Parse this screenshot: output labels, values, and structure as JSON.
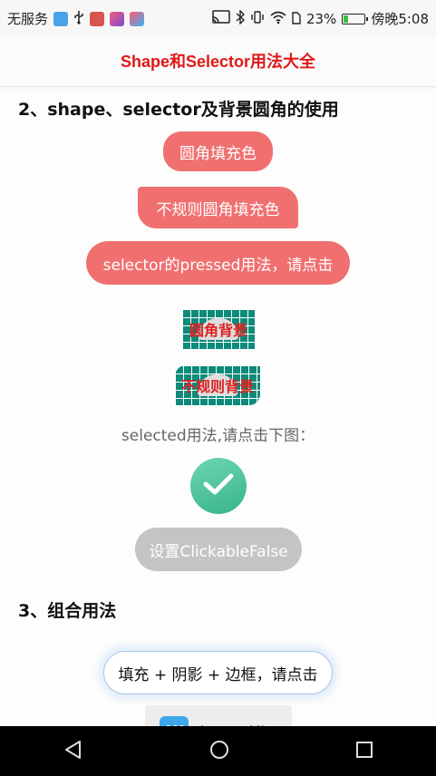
{
  "status_bar": {
    "carrier": "无服务",
    "battery_percent": "23%",
    "battery_level": 0.23,
    "time": "傍晚5:08",
    "icons": [
      "apowermirror-app-icon",
      "usb-icon",
      "huawei-app-icon",
      "app-icon",
      "app-icon",
      "cast-icon",
      "bluetooth-icon",
      "vibrate-icon",
      "wifi-icon",
      "sim-icon",
      "battery-icon"
    ]
  },
  "header": {
    "title": "Shape和Selector用法大全"
  },
  "section2": {
    "heading": "2、shape、selector及背景圆角的使用",
    "round_fill_label": "圆角填充色",
    "irregular_fill_label": "不规则圆角填充色",
    "pressed_label": "selector的pressed用法，请点击",
    "round_bg_label": "圆角背景",
    "irregular_bg_label": "不规则背景",
    "selected_hint": "selected用法,请点击下图：",
    "disabled_label": "设置ClickableFalse"
  },
  "section3": {
    "heading": "3、组合用法",
    "combo_label": "填充 + 阴影 + 边框，请点击"
  },
  "overlay": {
    "app_name": "ApowerMirror",
    "logo_text": "AM"
  },
  "colors": {
    "title_red": "#e01818",
    "pill_red": "#f07070",
    "grid_teal": "#0c8a7a",
    "check_green": "#4cc49a",
    "disabled_gray": "#c4c4c4"
  }
}
